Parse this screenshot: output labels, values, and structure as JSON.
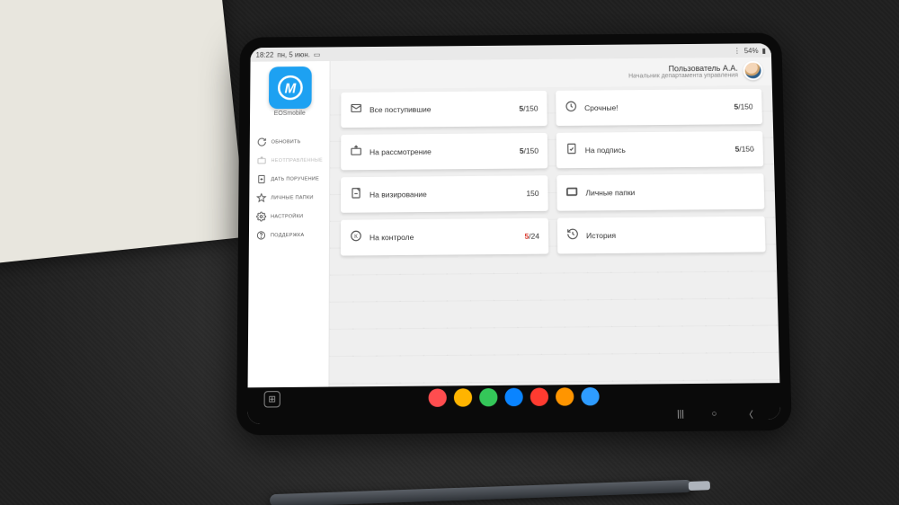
{
  "statusbar": {
    "time": "18:22",
    "date": "пн, 5 июн.",
    "battery": "54%"
  },
  "app": {
    "name": "EOSmobile",
    "logo_letter": "M"
  },
  "menu": [
    {
      "id": "refresh",
      "label": "ОБНОВИТЬ"
    },
    {
      "id": "unsent",
      "label": "НЕОТПРАВЛЕННЫЕ"
    },
    {
      "id": "assign",
      "label": "ДАТЬ ПОРУЧЕНИЕ"
    },
    {
      "id": "folders",
      "label": "ЛИЧНЫЕ ПАПКИ"
    },
    {
      "id": "settings",
      "label": "НАСТРОЙКИ"
    },
    {
      "id": "support",
      "label": "ПОДДЕРЖКА"
    }
  ],
  "user": {
    "name": "Пользователь А.А.",
    "title": "Начальник департамента управления"
  },
  "cards": [
    {
      "id": "all",
      "label": "Все поступившие",
      "bold": "5",
      "total": "150",
      "bold_red": false
    },
    {
      "id": "urgent",
      "label": "Срочные!",
      "bold": "5",
      "total": "150",
      "bold_red": false
    },
    {
      "id": "review",
      "label": "На рассмотрение",
      "bold": "5",
      "total": "150",
      "bold_red": false
    },
    {
      "id": "sign",
      "label": "На подпись",
      "bold": "5",
      "total": "150",
      "bold_red": false
    },
    {
      "id": "visa",
      "label": "На визирование",
      "bold": "",
      "total": "150",
      "bold_red": false
    },
    {
      "id": "personal",
      "label": "Личные папки",
      "bold": "",
      "total": "",
      "bold_red": false
    },
    {
      "id": "control",
      "label": "На контроле",
      "bold": "5",
      "total": "24",
      "bold_red": true
    },
    {
      "id": "history",
      "label": "История",
      "bold": "",
      "total": "",
      "bold_red": false
    }
  ],
  "dock_colors": [
    "#ff4d4f",
    "#ffb400",
    "#34c759",
    "#0a84ff",
    "#ff3b30",
    "#ff9500",
    "#2e9cff"
  ]
}
